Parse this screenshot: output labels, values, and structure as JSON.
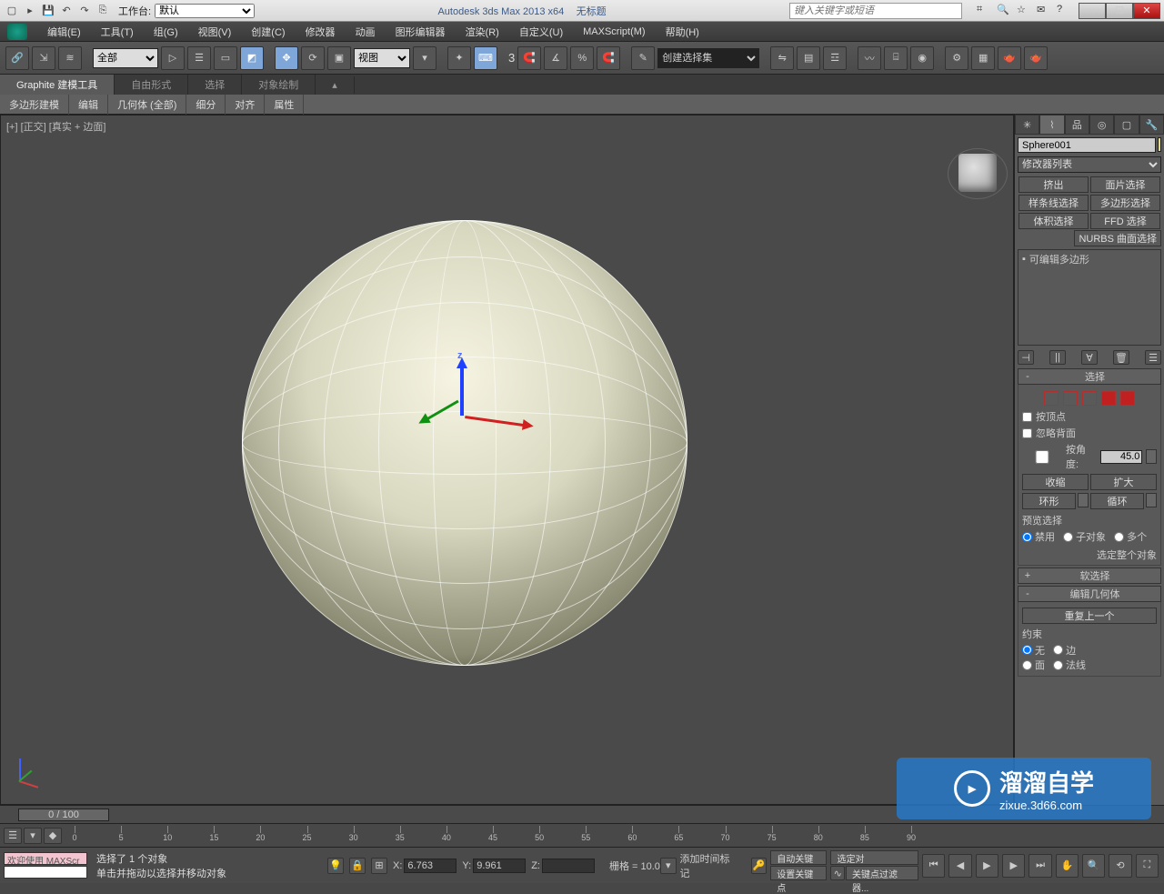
{
  "title": {
    "app": "Autodesk 3ds Max 2013 x64",
    "doc": "无标题",
    "workspace_label": "工作台:",
    "workspace_value": "默认",
    "search_placeholder": "键入关键字或短语"
  },
  "menu": {
    "edit": "编辑(E)",
    "tools": "工具(T)",
    "group": "组(G)",
    "views": "视图(V)",
    "create": "创建(C)",
    "modifiers": "修改器",
    "anim": "动画",
    "graph": "图形编辑器",
    "render": "渲染(R)",
    "custom": "自定义(U)",
    "maxscript": "MAXScript(M)",
    "help": "帮助(H)"
  },
  "toolbar": {
    "all": "全部",
    "refcoord": "视图",
    "selset_placeholder": "创建选择集",
    "three": "3"
  },
  "ribbon": {
    "tabs": [
      "Graphite 建模工具",
      "自由形式",
      "选择",
      "对象绘制"
    ],
    "subs": [
      "多边形建模",
      "编辑",
      "几何体 (全部)",
      "细分",
      "对齐",
      "属性"
    ]
  },
  "viewport": {
    "label": "[+] [正交] [真实 + 边面]",
    "zlab": "z"
  },
  "cmd": {
    "object_name": "Sphere001",
    "modlist": "修改器列表",
    "btns": [
      "挤出",
      "面片选择",
      "样条线选择",
      "多边形选择",
      "体积选择",
      "FFD 选择"
    ],
    "nurbs": "NURBS 曲面选择",
    "stack_item": "可编辑多边形",
    "sel_title": "选择",
    "by_vertex": "按顶点",
    "ignore_back": "忽略背面",
    "by_angle": "按角度:",
    "angle_val": "45.0",
    "shrink": "收缩",
    "grow": "扩大",
    "ring": "环形",
    "loop": "循环",
    "preview": "预览选择",
    "disable": "禁用",
    "subobj": "子对象",
    "multi": "多个",
    "select_whole": "选定整个对象",
    "soft": "软选择",
    "editgeo": "编辑几何体",
    "repeat": "重复上一个",
    "constraint": "约束",
    "c_none": "无",
    "c_edge": "边",
    "c_face": "面",
    "c_normal": "法线"
  },
  "timeline": {
    "slider": "0 / 100",
    "ticks": [
      0,
      5,
      10,
      15,
      20,
      25,
      30,
      35,
      40,
      45,
      50,
      55,
      60,
      65,
      70,
      75,
      80,
      85,
      90
    ]
  },
  "status": {
    "welcome": "欢迎使用 MAXScr",
    "sel": "选择了 1 个对象",
    "hint": "单击并拖动以选择并移动对象",
    "x": "6.763",
    "y": "9.961",
    "z": "",
    "grid": "栅格 = 10.0",
    "addtime": "添加时间标记",
    "autokey": "自动关键点",
    "setkey": "设置关键点",
    "keyfilter": "关键点过滤器...",
    "selonly": "选定对"
  },
  "watermark": {
    "text": "溜溜自学",
    "url": "zixue.3d66.com"
  }
}
